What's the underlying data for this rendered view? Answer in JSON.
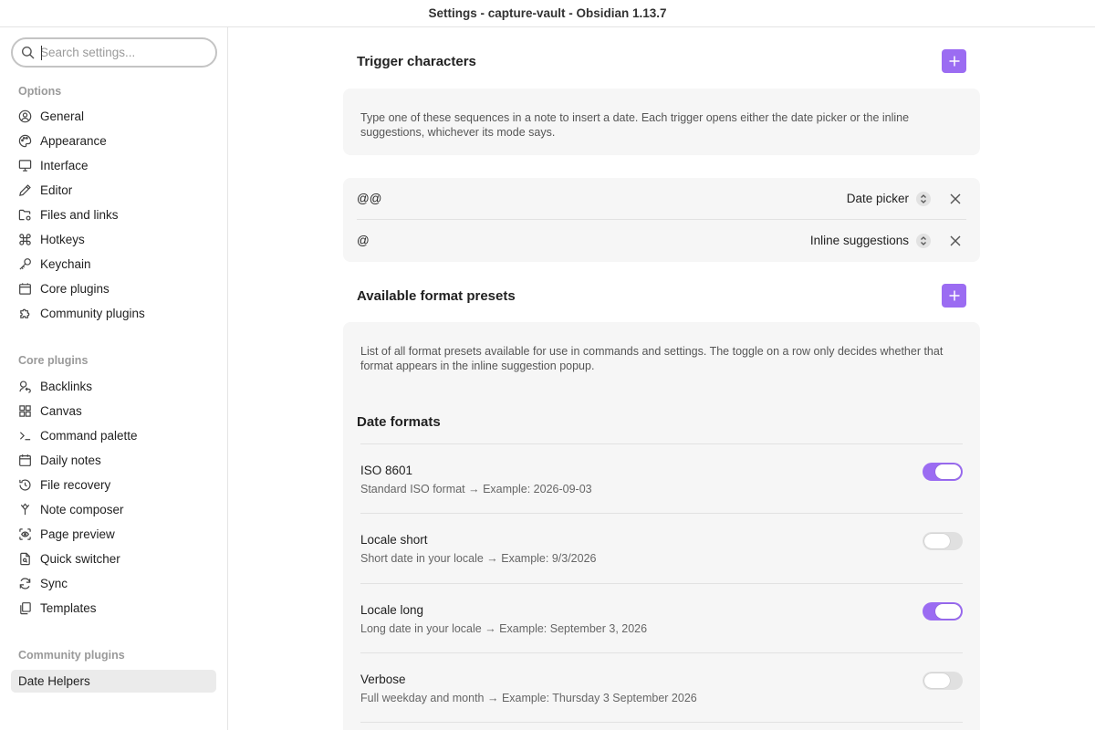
{
  "window": {
    "title": "Settings - capture-vault - Obsidian 1.13.7"
  },
  "sidebar": {
    "search_placeholder": "Search settings...",
    "options_header": "Options",
    "options": [
      "General",
      "Appearance",
      "Interface",
      "Editor",
      "Files and links",
      "Hotkeys",
      "Keychain",
      "Core plugins",
      "Community plugins"
    ],
    "core_header": "Core plugins",
    "core": [
      "Backlinks",
      "Canvas",
      "Command palette",
      "Daily notes",
      "File recovery",
      "Note composer",
      "Page preview",
      "Quick switcher",
      "Sync",
      "Templates"
    ],
    "community_header": "Community plugins",
    "community": [
      "Date Helpers"
    ]
  },
  "main": {
    "trigger": {
      "title": "Trigger characters",
      "description": "Type one of these sequences in a note to insert a date. Each trigger opens either the date picker or the inline suggestions, whichever its mode says.",
      "rows": [
        {
          "key": "@@",
          "mode": "Date picker"
        },
        {
          "key": "@",
          "mode": "Inline suggestions"
        }
      ]
    },
    "presets": {
      "title": "Available format presets",
      "description": "List of all format presets available for use in commands and settings. The toggle on a row only decides whether that format appears in the inline suggestion popup.",
      "date_formats_title": "Date formats",
      "rows": [
        {
          "name": "ISO 8601",
          "desc": "Standard ISO format → Example: 2026-09-03",
          "enabled": true
        },
        {
          "name": "Locale short",
          "desc": "Short date in your locale → Example: 9/3/2026",
          "enabled": false
        },
        {
          "name": "Locale long",
          "desc": "Long date in your locale → Example: September 3, 2026",
          "enabled": true
        },
        {
          "name": "Verbose",
          "desc": "Full weekday and month → Example: Thursday 3 September 2026",
          "enabled": false
        }
      ]
    }
  },
  "colors": {
    "accent": "#9b6cf2",
    "panel": "#f6f6f6",
    "active_item": "#ebebeb"
  }
}
